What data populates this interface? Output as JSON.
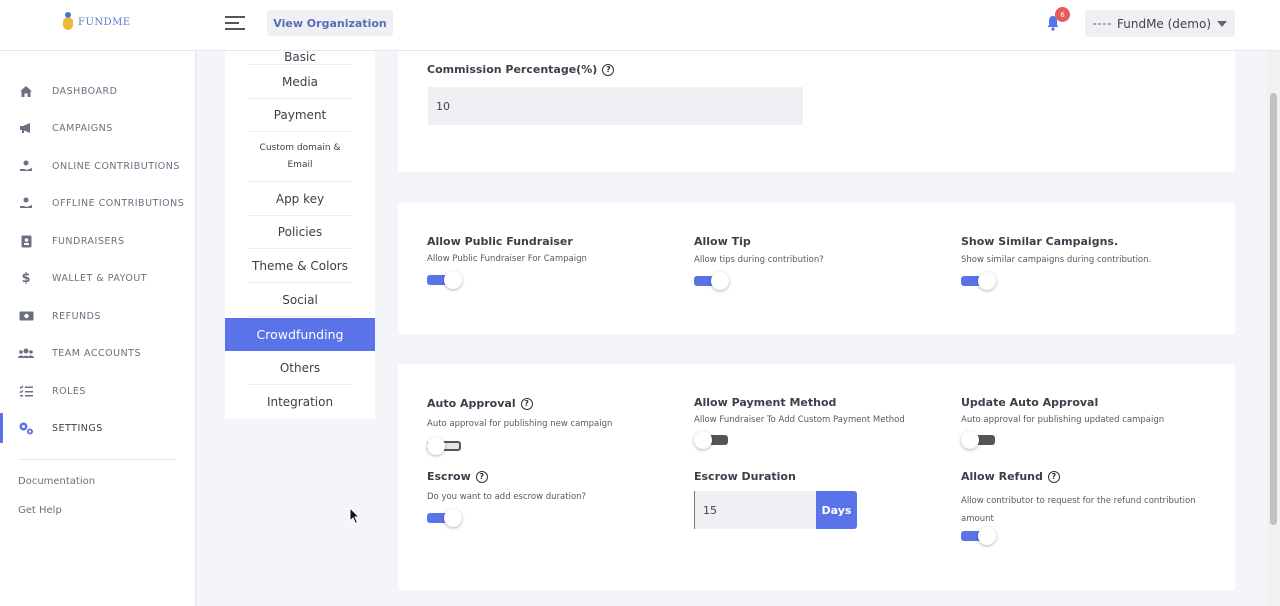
{
  "header": {
    "logo_text": "FUNDME",
    "view_org_label": "View Organization",
    "notification_count": "6",
    "org_name": "FundMe (demo)"
  },
  "sidebar": {
    "items": [
      {
        "label": "DASHBOARD",
        "icon": "home-icon"
      },
      {
        "label": "CAMPAIGNS",
        "icon": "megaphone-icon"
      },
      {
        "label": "ONLINE CONTRIBUTIONS",
        "icon": "hand-coin-icon"
      },
      {
        "label": "OFFLINE CONTRIBUTIONS",
        "icon": "hand-coin-icon"
      },
      {
        "label": "FUNDRAISERS",
        "icon": "id-badge-icon"
      },
      {
        "label": "WALLET & PAYOUT",
        "icon": "dollar-icon"
      },
      {
        "label": "REFUNDS",
        "icon": "money-bill-icon"
      },
      {
        "label": "TEAM ACCOUNTS",
        "icon": "users-icon"
      },
      {
        "label": "ROLES",
        "icon": "list-check-icon"
      },
      {
        "label": "SETTINGS",
        "icon": "gears-icon"
      }
    ],
    "active_item": "SETTINGS",
    "links": [
      "Documentation",
      "Get Help"
    ]
  },
  "submenu": {
    "items": [
      "Basic",
      "Media",
      "Payment",
      "Custom domain & Email",
      "App key",
      "Policies",
      "Theme & Colors",
      "Social",
      "Crowdfunding",
      "Others",
      "Integration"
    ],
    "active_item": "Crowdfunding"
  },
  "commission": {
    "label": "Commission Percentage(%)",
    "value": "10"
  },
  "fundraiser_options": {
    "allow_public_fundraiser": {
      "label": "Allow Public Fundraiser",
      "description": "Allow Public Fundraiser For Campaign",
      "enabled": true
    },
    "allow_tip": {
      "label": "Allow Tip",
      "description": "Allow tips during contribution?",
      "enabled": true
    },
    "show_similar": {
      "label": "Show Similar Campaigns.",
      "description": "Show similar campaigns during contribution.",
      "enabled": true
    }
  },
  "approval_options": {
    "auto_approval": {
      "label": "Auto Approval",
      "description": "Auto approval for publishing new campaign",
      "enabled": false
    },
    "allow_payment_method": {
      "label": "Allow Payment Method",
      "description": "Allow Fundraiser To Add Custom Payment Method",
      "enabled": false
    },
    "update_auto_approval": {
      "label": "Update Auto Approval",
      "description": "Auto approval for publishing updated campaign",
      "enabled": false
    },
    "escrow": {
      "label": "Escrow",
      "description": "Do you want to add escrow duration?",
      "enabled": true
    },
    "escrow_duration": {
      "label": "Escrow Duration",
      "value": "15",
      "unit": "Days"
    },
    "allow_refund": {
      "label": "Allow Refund",
      "description": "Allow contributor to request for the refund contribution amount",
      "enabled": true
    }
  },
  "colors": {
    "accent": "#5a73e8",
    "badge": "#e65c5c"
  }
}
